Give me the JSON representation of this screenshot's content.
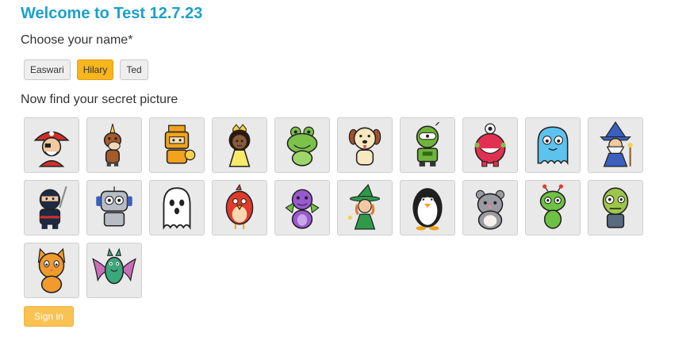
{
  "header": {
    "title": "Welcome to Test 12.7.23"
  },
  "names": {
    "prompt": "Choose your name*",
    "options": [
      "Easwari",
      "Hilary",
      "Ted"
    ],
    "selected": "Hilary"
  },
  "pictures": {
    "prompt": "Now find your secret picture",
    "items": [
      {
        "icon": "pirate-icon"
      },
      {
        "icon": "unicorn-icon"
      },
      {
        "icon": "robot-knight-icon"
      },
      {
        "icon": "princess-icon"
      },
      {
        "icon": "frog-icon"
      },
      {
        "icon": "dog-icon"
      },
      {
        "icon": "green-robot-icon"
      },
      {
        "icon": "red-monster-icon"
      },
      {
        "icon": "blue-ghost-monster-icon"
      },
      {
        "icon": "wizard-icon"
      },
      {
        "icon": "ninja-icon"
      },
      {
        "icon": "gray-robot-icon"
      },
      {
        "icon": "ghost-icon"
      },
      {
        "icon": "red-bird-icon"
      },
      {
        "icon": "purple-dragon-icon"
      },
      {
        "icon": "witch-icon"
      },
      {
        "icon": "penguin-icon"
      },
      {
        "icon": "hamster-icon"
      },
      {
        "icon": "alien-icon"
      },
      {
        "icon": "zombie-icon"
      },
      {
        "icon": "cat-icon"
      },
      {
        "icon": "bat-icon"
      }
    ]
  },
  "actions": {
    "sign_in_label": "Sign in"
  },
  "colors": {
    "title": "#1ba1c8",
    "selected_name": "#f7b51e",
    "sign_in": "#f9c253",
    "tile_background": "#e9e9e9"
  }
}
